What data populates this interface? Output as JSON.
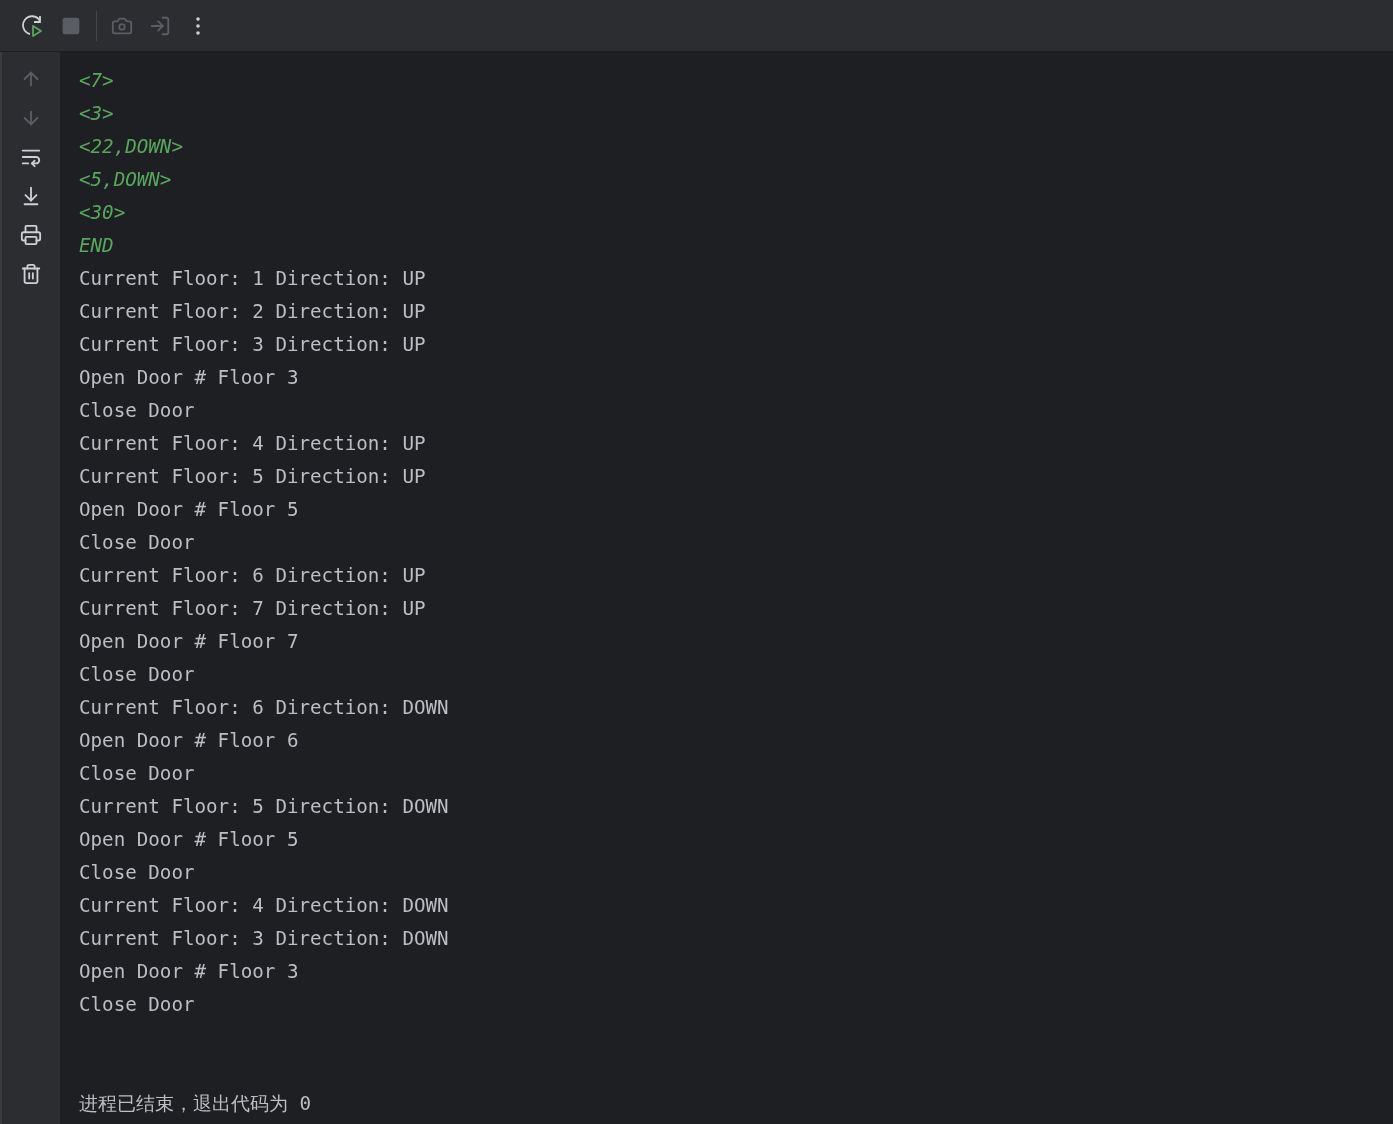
{
  "toolbar": [
    {
      "kind": "rerun",
      "disabled": false
    },
    {
      "kind": "stop",
      "disabled": true
    },
    {
      "kind": "separator"
    },
    {
      "kind": "camera",
      "disabled": true
    },
    {
      "kind": "attach",
      "disabled": true
    },
    {
      "kind": "more",
      "disabled": false
    }
  ],
  "sidebar": [
    {
      "kind": "up",
      "disabled": true
    },
    {
      "kind": "down",
      "disabled": true
    },
    {
      "kind": "wrap",
      "disabled": false
    },
    {
      "kind": "scroll-end",
      "disabled": false
    },
    {
      "kind": "print",
      "disabled": false
    },
    {
      "kind": "clear",
      "disabled": false
    }
  ],
  "console_lines": [
    {
      "kind": "input",
      "text": "<7>"
    },
    {
      "kind": "input",
      "text": "<3>"
    },
    {
      "kind": "input",
      "text": "<22,DOWN>"
    },
    {
      "kind": "input",
      "text": "<5,DOWN>"
    },
    {
      "kind": "input",
      "text": "<30>"
    },
    {
      "kind": "input",
      "text": "END"
    },
    {
      "kind": "output",
      "text": "Current Floor: 1 Direction: UP"
    },
    {
      "kind": "output",
      "text": "Current Floor: 2 Direction: UP"
    },
    {
      "kind": "output",
      "text": "Current Floor: 3 Direction: UP"
    },
    {
      "kind": "output",
      "text": "Open Door # Floor 3"
    },
    {
      "kind": "output",
      "text": "Close Door"
    },
    {
      "kind": "output",
      "text": "Current Floor: 4 Direction: UP"
    },
    {
      "kind": "output",
      "text": "Current Floor: 5 Direction: UP"
    },
    {
      "kind": "output",
      "text": "Open Door # Floor 5"
    },
    {
      "kind": "output",
      "text": "Close Door"
    },
    {
      "kind": "output",
      "text": "Current Floor: 6 Direction: UP"
    },
    {
      "kind": "output",
      "text": "Current Floor: 7 Direction: UP"
    },
    {
      "kind": "output",
      "text": "Open Door # Floor 7"
    },
    {
      "kind": "output",
      "text": "Close Door"
    },
    {
      "kind": "output",
      "text": "Current Floor: 6 Direction: DOWN"
    },
    {
      "kind": "output",
      "text": "Open Door # Floor 6"
    },
    {
      "kind": "output",
      "text": "Close Door"
    },
    {
      "kind": "output",
      "text": "Current Floor: 5 Direction: DOWN"
    },
    {
      "kind": "output",
      "text": "Open Door # Floor 5"
    },
    {
      "kind": "output",
      "text": "Close Door"
    },
    {
      "kind": "output",
      "text": "Current Floor: 4 Direction: DOWN"
    },
    {
      "kind": "output",
      "text": "Current Floor: 3 Direction: DOWN"
    },
    {
      "kind": "output",
      "text": "Open Door # Floor 3"
    },
    {
      "kind": "output",
      "text": "Close Door"
    },
    {
      "kind": "gap"
    },
    {
      "kind": "gap"
    },
    {
      "kind": "system",
      "text": "进程已结束，退出代码为 0"
    }
  ]
}
